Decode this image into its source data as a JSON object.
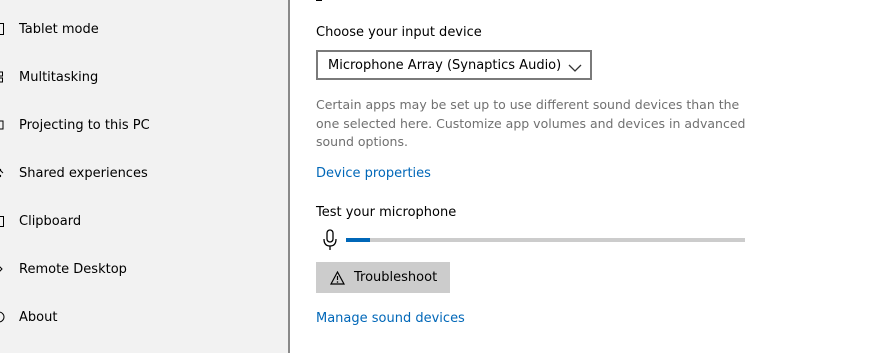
{
  "sidebar": {
    "items": [
      {
        "label": "Tablet mode",
        "icon": "tablet-mode-icon"
      },
      {
        "label": "Multitasking",
        "icon": "multitasking-icon"
      },
      {
        "label": "Projecting to this PC",
        "icon": "projecting-icon"
      },
      {
        "label": "Shared experiences",
        "icon": "shared-experiences-icon"
      },
      {
        "label": "Clipboard",
        "icon": "clipboard-icon"
      },
      {
        "label": "Remote Desktop",
        "icon": "remote-desktop-icon"
      },
      {
        "label": "About",
        "icon": "info-icon"
      }
    ]
  },
  "input": {
    "choose_label": "Choose your input device",
    "device_selected": "Microphone Array (Synaptics Audio)",
    "help_text": "Certain apps may be set up to use different sound devices than the one selected here. Customize app volumes and devices in advanced sound options.",
    "device_properties_link": "Device properties",
    "test_label": "Test your microphone",
    "mic_level": 0.06,
    "troubleshoot_label": "Troubleshoot",
    "manage_link": "Manage sound devices"
  },
  "colors": {
    "accent": "#0067b8",
    "sidebar_bg": "#f2f2f2",
    "help_text": "#707070",
    "button_bg": "#cccccc"
  }
}
